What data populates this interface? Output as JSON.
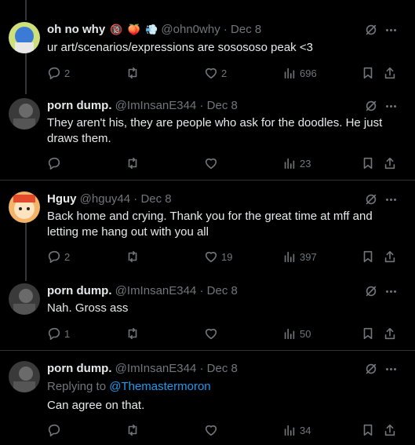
{
  "tweets": [
    {
      "name": "oh no why",
      "emojis": [
        "🔞",
        "🍑",
        "💨"
      ],
      "handle": "@ohn0why",
      "dot": "·",
      "date": "Dec 8",
      "text": "ur art/scenarios/expressions are sosososo peak <3",
      "replies": "2",
      "retweets": "",
      "likes": "2",
      "views": "696"
    },
    {
      "name": "porn dump.",
      "handle": "@ImInsanE344",
      "dot": "·",
      "date": "Dec 8",
      "text": "They aren't his, they are people who ask for the doodles. He just draws them.",
      "replies": "",
      "retweets": "",
      "likes": "",
      "views": "23"
    },
    {
      "name": "Hguy",
      "handle": "@hguy44",
      "dot": "·",
      "date": "Dec 8",
      "text": "Back home and crying. Thank you for the great time at mff and letting me hang out with you all",
      "replies": "2",
      "retweets": "",
      "likes": "19",
      "views": "397"
    },
    {
      "name": "porn dump.",
      "handle": "@ImInsanE344",
      "dot": "·",
      "date": "Dec 8",
      "text": "Nah. Gross ass",
      "replies": "1",
      "retweets": "",
      "likes": "",
      "views": "50"
    },
    {
      "name": "porn dump.",
      "handle": "@ImInsanE344",
      "dot": "·",
      "date": "Dec 8",
      "replying_prefix": "Replying to",
      "replying_to": "@Themastermoron",
      "text": "Can agree on that.",
      "replies": "",
      "retweets": "",
      "likes": "",
      "views": "34"
    }
  ],
  "colors": {
    "background": "#000000",
    "text": "#e7e9ea",
    "muted": "#71767b",
    "link": "#1d9bf0",
    "divider": "#2f3336"
  },
  "icons": [
    "reply-icon",
    "retweet-icon",
    "like-icon",
    "views-icon",
    "bookmark-icon",
    "share-icon",
    "grok-icon",
    "more-icon"
  ]
}
